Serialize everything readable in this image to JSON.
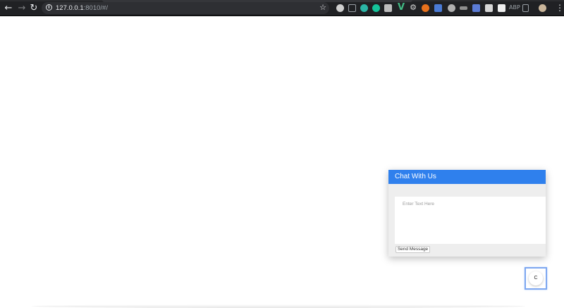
{
  "browser": {
    "url_host": "127.0.0.1",
    "url_rest": ":8010/#/",
    "nav": {
      "back_icon": "arrow-left-icon",
      "forward_icon": "arrow-right-icon",
      "reload_icon": "reload-icon"
    },
    "extensions": [
      {
        "name": "ext-1-icon",
        "color": "#cfcfcf"
      },
      {
        "name": "ext-pocket-icon",
        "color": "#9aa0a6"
      },
      {
        "name": "ext-3-icon",
        "color": "#2bb5a6"
      },
      {
        "name": "ext-grammarly-icon",
        "color": "#15c39a"
      },
      {
        "name": "ext-5-icon",
        "color": "#bdbdbd"
      },
      {
        "name": "ext-vue-icon",
        "color": "#41b883"
      },
      {
        "name": "ext-gear-icon",
        "color": "#dadada"
      },
      {
        "name": "ext-8-icon",
        "color": "#e8711c"
      },
      {
        "name": "ext-translate-icon",
        "color": "#4a7bd6"
      },
      {
        "name": "ext-10-icon",
        "color": "#b0b0b0"
      },
      {
        "name": "ext-11-icon",
        "color": "#8e8e8e"
      },
      {
        "name": "ext-12-icon",
        "color": "#5b7bd5"
      },
      {
        "name": "ext-13-icon",
        "color": "#d7d7d7"
      },
      {
        "name": "ext-s-icon",
        "color": "#efefef"
      },
      {
        "name": "ext-15-icon",
        "color": "#9aa0a6"
      }
    ],
    "ext_text": "ABP"
  },
  "chat": {
    "title": "Chat With Us",
    "input_placeholder": "Enter Text Here",
    "send_label": "Send Message",
    "accent_color": "#2f80ed"
  },
  "launcher": {
    "label": "C"
  }
}
